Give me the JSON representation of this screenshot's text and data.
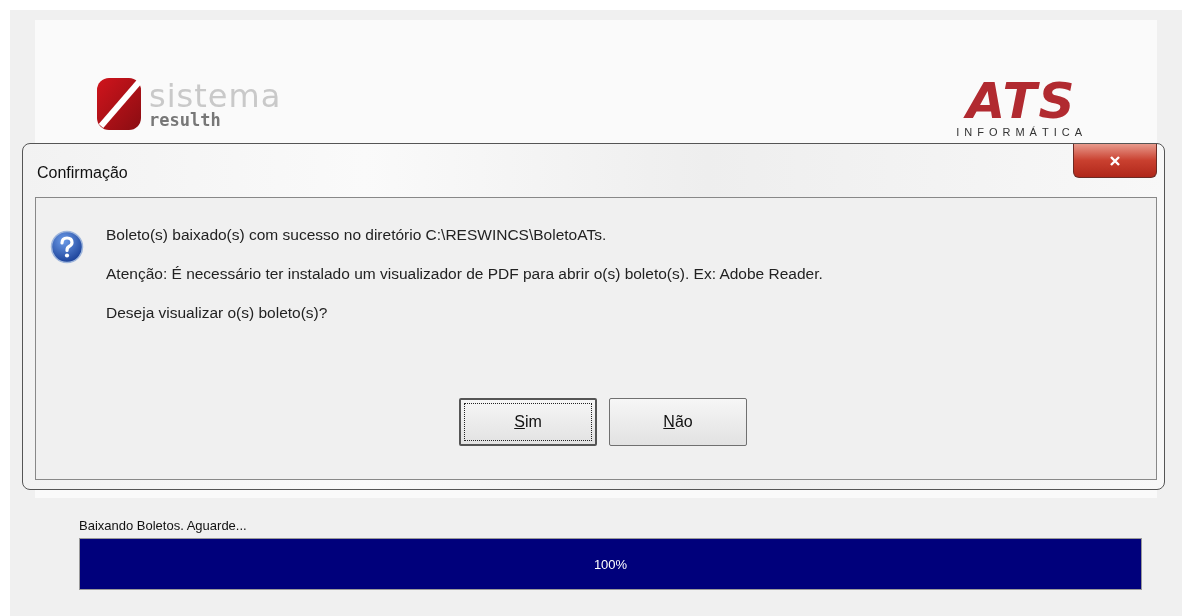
{
  "main_window": {
    "logos": [
      {
        "kind": "sistema",
        "line_1": "sistema",
        "line_2": "resulth"
      },
      {
        "kind": "ats",
        "line_1": "ATS",
        "line_2": "INFORMÁTICA"
      }
    ],
    "progress": {
      "label": "Baixando Boletos. Aguarde...",
      "level": 1,
      "reading": "100%"
    }
  },
  "dialog": {
    "title": "Confirmação",
    "messages": [
      "Boleto(s) baixado(s) com sucesso no diretório C:\\RESWINCS\\BoletoATs.",
      "Atenção: É necessário ter instalado um visualizador de PDF para abrir o(s) boleto(s). Ex: Adobe Reader.",
      "Deseja visualizar o(s) boleto(s)?"
    ],
    "buttons": [
      {
        "label": "Sim",
        "focused": true
      },
      {
        "label": "Não",
        "focused": false
      }
    ]
  }
}
